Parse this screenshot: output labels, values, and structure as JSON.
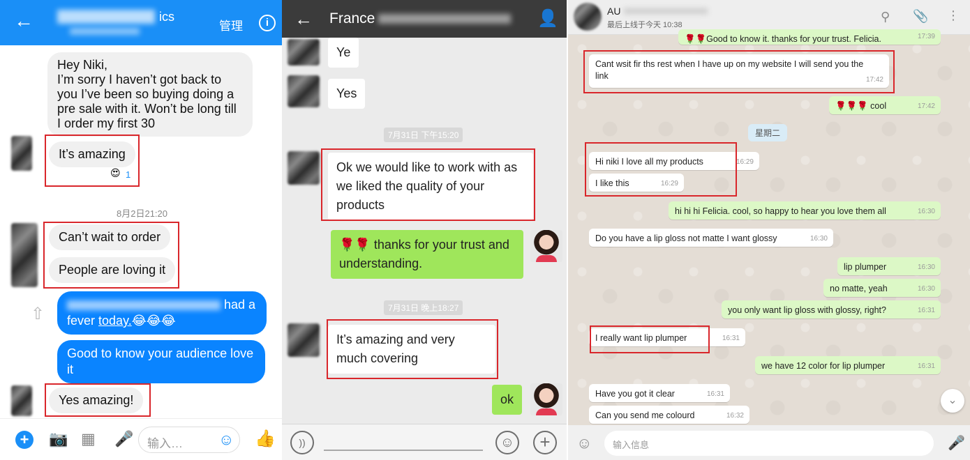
{
  "messenger": {
    "header_title": "ics",
    "header_sub": "",
    "admin_label": "管理",
    "messages": {
      "m1": "Hey Niki,\nI’m sorry I haven’t got back to you I’ve been so buying doing a pre sale with it. Won’t be long till I order my first 30",
      "m2": "It’s amazing",
      "reaction_count": "1",
      "timestamp": "8月2日21:20",
      "m3": "Can’t wait to order",
      "m4": "People are loving it",
      "m5_suffix": "had a",
      "m5_line2": "fever ",
      "m5_link": "today.",
      "m5_emoji": "😂😂😂",
      "m6": "Good to know your audience love it",
      "m7": "Yes amazing!"
    },
    "composer_placeholder": "输入…"
  },
  "wechat": {
    "header_title": "France",
    "messages": {
      "r1": "Ye",
      "r2": "Yes",
      "ts1": "7月31日 下午15:20",
      "r3": "Ok we would like to work with as we liked the quality of your products",
      "s1_roses": "🌹🌹",
      "s1": "thanks for your trust and understanding.",
      "ts2": "7月31日 晚上18:27",
      "r4": "It’s amazing and very much covering",
      "s2": "ok"
    }
  },
  "whatsapp": {
    "contact_name": "AU",
    "status": "最后上线于今天 10:38",
    "day_label": "星期二",
    "composer_placeholder": "输入信息",
    "messages": [
      {
        "text": "🌹🌹Good to know it. thanks for your trust. Felicia.",
        "time": "17:39"
      },
      {
        "text": "Cant wsit fir ths rest when I have up on my website I will send you the link",
        "time": "17:42"
      },
      {
        "text": "🌹🌹🌹 cool",
        "time": "17:42"
      },
      {
        "text": "Hi niki I love all my products",
        "time": "16:29"
      },
      {
        "text": "I like this",
        "time": "16:29"
      },
      {
        "text": "hi hi hi Felicia. cool, so happy to hear you love them all",
        "time": "16:30"
      },
      {
        "text": "Do you have a lip gloss not matte I want glossy",
        "time": "16:30"
      },
      {
        "text": "lip plumper",
        "time": "16:30"
      },
      {
        "text": "no matte, yeah",
        "time": "16:30"
      },
      {
        "text": "you only want lip gloss with glossy, right?",
        "time": "16:31"
      },
      {
        "text": "I really want lip plumper",
        "time": "16:31"
      },
      {
        "text": "we have 12 color for lip plumper",
        "time": "16:31"
      },
      {
        "text": "Have you got it clear",
        "time": "16:31"
      },
      {
        "text": "Can you send me colourd",
        "time": "16:32"
      }
    ]
  },
  "colors": {
    "messenger_blue": "#1a8ff7",
    "wechat_green": "#9fe65b",
    "whatsapp_out": "#dcf8c6",
    "highlight_red": "#d9262b"
  }
}
